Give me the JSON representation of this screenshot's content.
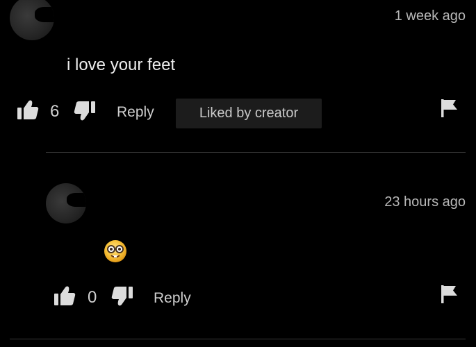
{
  "comments": [
    {
      "timestamp": "1 week ago",
      "text": "i love your feet",
      "like_count": "6",
      "reply_label": "Reply",
      "badge": "Liked by creator"
    },
    {
      "timestamp": "23 hours ago",
      "text_emoji": "nerd-face-emoji",
      "like_count": "0",
      "reply_label": "Reply"
    }
  ],
  "icons": {
    "like": "thumbs-up-icon",
    "dislike": "thumbs-down-icon",
    "report": "flag-icon"
  },
  "colors": {
    "background": "#000000",
    "text": "#ececec",
    "muted": "#b8b8b8",
    "badge_bg": "#1c1c1c",
    "divider": "#3a3a3a"
  }
}
